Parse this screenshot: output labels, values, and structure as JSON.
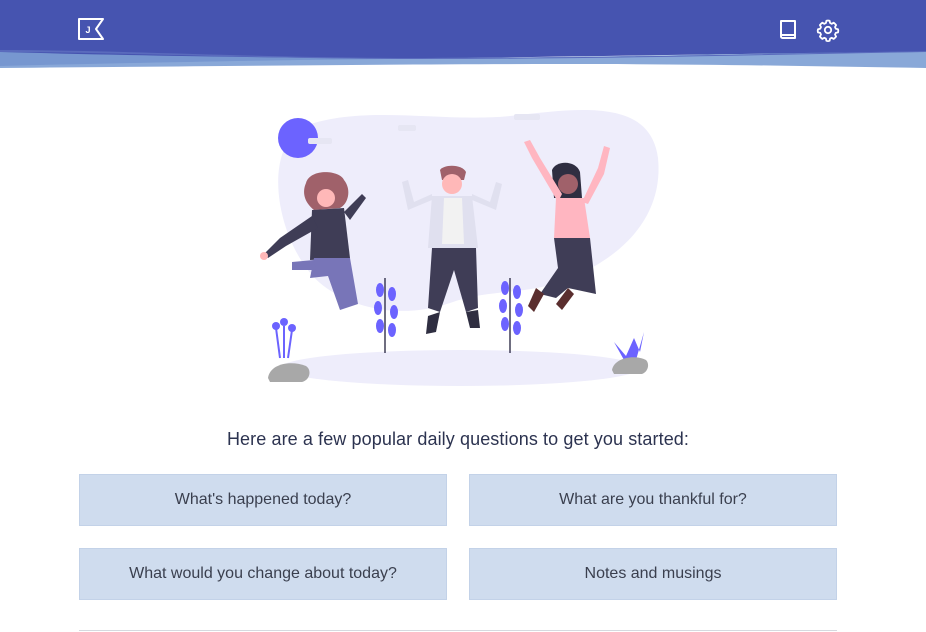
{
  "header": {
    "logo_icon": "journal-logo-icon",
    "logo_letter": "J",
    "actions": [
      {
        "icon": "book-icon"
      },
      {
        "icon": "gear-icon"
      }
    ],
    "colors": {
      "band": "#4654b0",
      "wave": "#7c9fd4"
    }
  },
  "hero": {
    "illustration": "people-jumping-illustration",
    "accent": "#6c63ff"
  },
  "main": {
    "prompt_heading": "Here are a few popular daily questions to get you started:",
    "questions": [
      {
        "label": "What's happened today?"
      },
      {
        "label": "What are you thankful for?"
      },
      {
        "label": "What would you change about today?"
      },
      {
        "label": "Notes and musings"
      }
    ]
  },
  "colors": {
    "card_bg": "#cfdcee",
    "text": "#2c3350"
  }
}
